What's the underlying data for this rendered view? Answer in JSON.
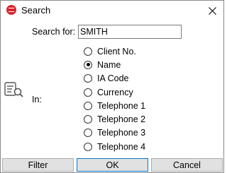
{
  "window": {
    "title": "Search",
    "app_icon": "lotus-app-icon",
    "close_icon": "close-icon"
  },
  "search": {
    "label": "Search for:",
    "value": "SMITH"
  },
  "in": {
    "label": "In:",
    "icon": "database-search-icon"
  },
  "options": [
    {
      "label": "Client No.",
      "checked": false
    },
    {
      "label": "Name",
      "checked": true
    },
    {
      "label": "IA Code",
      "checked": false
    },
    {
      "label": "Currency",
      "checked": false
    },
    {
      "label": "Telephone 1",
      "checked": false
    },
    {
      "label": "Telephone 2",
      "checked": false
    },
    {
      "label": "Telephone 3",
      "checked": false
    },
    {
      "label": "Telephone 4",
      "checked": false
    }
  ],
  "buttons": {
    "filter": "Filter",
    "ok": "OK",
    "cancel": "Cancel"
  },
  "colors": {
    "app_icon": "#d8262c",
    "default_button_border": "#0078d7",
    "button_bg": "#e1e1e1"
  }
}
